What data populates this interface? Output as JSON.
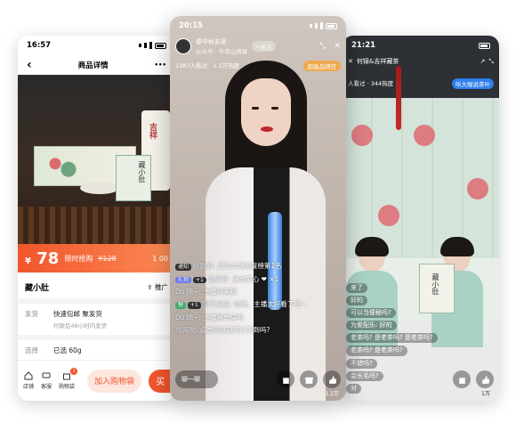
{
  "left": {
    "time": "16:57",
    "title": "商品详情",
    "back_icon": "‹",
    "more_icon": "•••",
    "tin_label": "藏小肚",
    "jar_label": "吉祥",
    "price_symbol": "¥",
    "price": "78",
    "price_label": "限时抢购",
    "original_price": "¥128",
    "countdown": "1 00",
    "product_name": "藏小肚",
    "promo": "推广",
    "ship_key": "发货",
    "ship_value": "快速包邮 聚发货",
    "ship_sub": "付款后48小时内发货",
    "select_key": "选择",
    "select_value": "已选 60g",
    "nav_shop": "店铺",
    "nav_service": "客服",
    "nav_cart": "购物袋",
    "cart_badge": "1",
    "add_cart": "加入购物袋",
    "buy": "买"
  },
  "middle": {
    "time": "20:15",
    "streamer": "春华秋实茗",
    "follow": "+关注",
    "subtitle": "公众号 · 牛背山清屋",
    "viewers": "1387人看过 · 1.2万热度",
    "rank": "超级品牌日",
    "msgs": [
      {
        "tag": "通知",
        "tagClass": "c",
        "user": "赵玩好:",
        "text": "成为本场热度榜第1名"
      },
      {
        "tag": "礼物",
        "tagClass": "a",
        "level": "+1",
        "user": "玩好好:",
        "text": "送出爱心 ❤ ×1"
      },
      {
        "tag": "",
        "tagClass": "",
        "user": "Do 晴~:",
        "text": "主播好美哦"
      },
      {
        "tag": "糖",
        "tagClass": "b",
        "level": "+1",
        "user": "宝贝说说:",
        "text": "哇哦，主播太好看了吧~"
      },
      {
        "tag": "",
        "tagClass": "",
        "user": "Do 晴~:",
        "text": "主播是单身吗"
      },
      {
        "tag": "",
        "tagClass": "",
        "user": "冷风吹:",
        "text": "点击链接就可以买到吗?"
      }
    ],
    "say": "聊一聊",
    "count": "1.2万"
  },
  "right": {
    "time": "21:21",
    "title": "何锦&吉祥藏茶",
    "viewers": "人看过 · 344热度",
    "pill": "听大咖说茶叶",
    "box_label": "藏小肚",
    "msgs": [
      "来了",
      "好的",
      "可以当便秘吗?",
      "为爱配乐: 好的",
      "老茶吗? 是老茶吗? 是老茶吗?",
      "老茶吗? 是老茶吗?",
      "不错吗?",
      "会长毛吗?",
      "对"
    ],
    "count": "1万"
  }
}
